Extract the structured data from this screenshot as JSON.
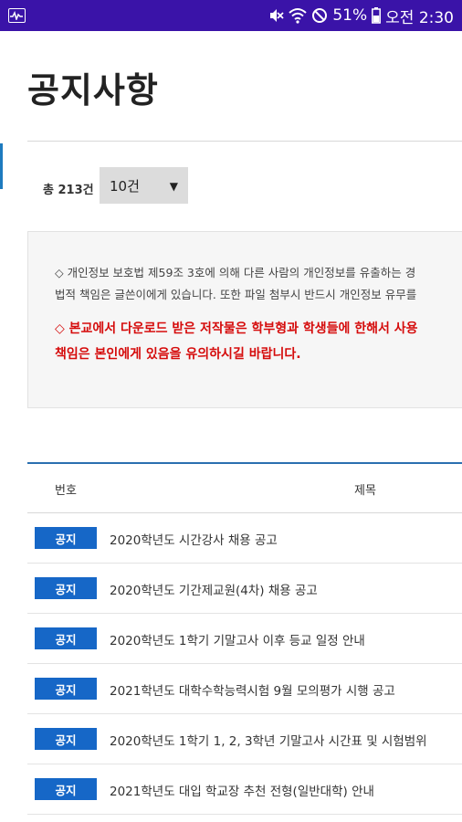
{
  "status_bar": {
    "battery": "51%",
    "time": "오전 2:30",
    "icons": [
      "activity-icon",
      "mute-icon",
      "wifi-icon",
      "do-not-disturb-icon",
      "battery-icon"
    ]
  },
  "page": {
    "title": "공지사항"
  },
  "listing": {
    "total": "총 213건",
    "page_size": "10건"
  },
  "notice": {
    "line1": "◇ 개인정보 보호법 제59조 3호에 의해 다른 사람의 개인정보를 유출하는 경",
    "line2": "법적 책임은 글쓴이에게 있습니다. 또한 파일 첨부시 반드시 개인정보 유무를",
    "red1": "◇ 본교에서 다운로드 받은 저작물은 학부형과 학생들에 한해서 사용",
    "red2": "책임은 본인에게 있음을 유의하시길 바랍니다."
  },
  "table": {
    "col_number": "번호",
    "col_title": "제목",
    "rows": [
      {
        "badge": "공지",
        "title": "2020학년도 시간강사 채용 공고"
      },
      {
        "badge": "공지",
        "title": "2020학년도 기간제교원(4차) 채용 공고"
      },
      {
        "badge": "공지",
        "title": "2020학년도 1학기 기말고사 이후 등교 일정 안내"
      },
      {
        "badge": "공지",
        "title": "2021학년도 대학수학능력시험 9월 모의평가 시행 공고"
      },
      {
        "badge": "공지",
        "title": "2020학년도 1학기 1, 2, 3학년 기말고사 시간표 및 시험범위"
      },
      {
        "badge": "공지",
        "title": "2021학년도 대입 학교장 추천 전형(일반대학) 안내"
      }
    ]
  },
  "colors": {
    "status_bar": "#3a13a8",
    "badge": "#1667c7",
    "warning_text": "#d50b0b",
    "table_top": "#2a6fb0"
  }
}
